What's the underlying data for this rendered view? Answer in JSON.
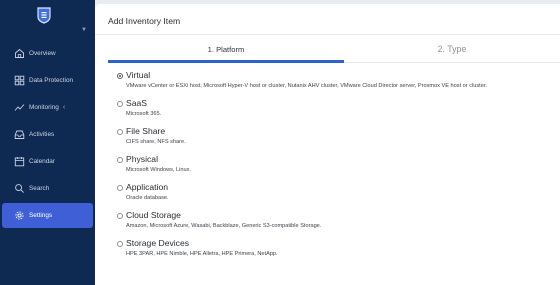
{
  "sidebar": {
    "items": [
      {
        "label": "Overview",
        "icon": "home-icon"
      },
      {
        "label": "Data Protection",
        "icon": "grid-icon"
      },
      {
        "label": "Monitoring",
        "icon": "chart-line-icon"
      },
      {
        "label": "Activities",
        "icon": "inbox-icon"
      },
      {
        "label": "Calendar",
        "icon": "calendar-icon"
      },
      {
        "label": "Search",
        "icon": "search-icon"
      },
      {
        "label": "Settings",
        "icon": "gear-icon"
      }
    ],
    "active_item": "Settings",
    "accent_color": "#3f5fd6",
    "background_color": "#0f2a52"
  },
  "panel": {
    "title": "Add Inventory Item"
  },
  "steps": [
    {
      "label": "1. Platform",
      "active": true
    },
    {
      "label": "2. Type",
      "active": false
    }
  ],
  "options": [
    {
      "name": "Virtual",
      "description": "VMware vCenter or ESXi host, Microsoft Hyper-V host or cluster, Nutanix AHV cluster, VMware Cloud Director server, Proxmox VE host or cluster.",
      "selected": true
    },
    {
      "name": "SaaS",
      "description": "Microsoft 365.",
      "selected": false
    },
    {
      "name": "File Share",
      "description": "CIFS share, NFS share.",
      "selected": false
    },
    {
      "name": "Physical",
      "description": "Microsoft Windows, Linux.",
      "selected": false
    },
    {
      "name": "Application",
      "description": "Oracle database.",
      "selected": false
    },
    {
      "name": "Cloud Storage",
      "description": "Amazon, Microsoft Azure, Wasabi, Backblaze, Generic S3-compatible Storage.",
      "selected": false
    },
    {
      "name": "Storage Devices",
      "description": "HPE 3PAR, HPE Nimble, HPE Alletra, HPE Primera, NetApp.",
      "selected": false
    }
  ]
}
